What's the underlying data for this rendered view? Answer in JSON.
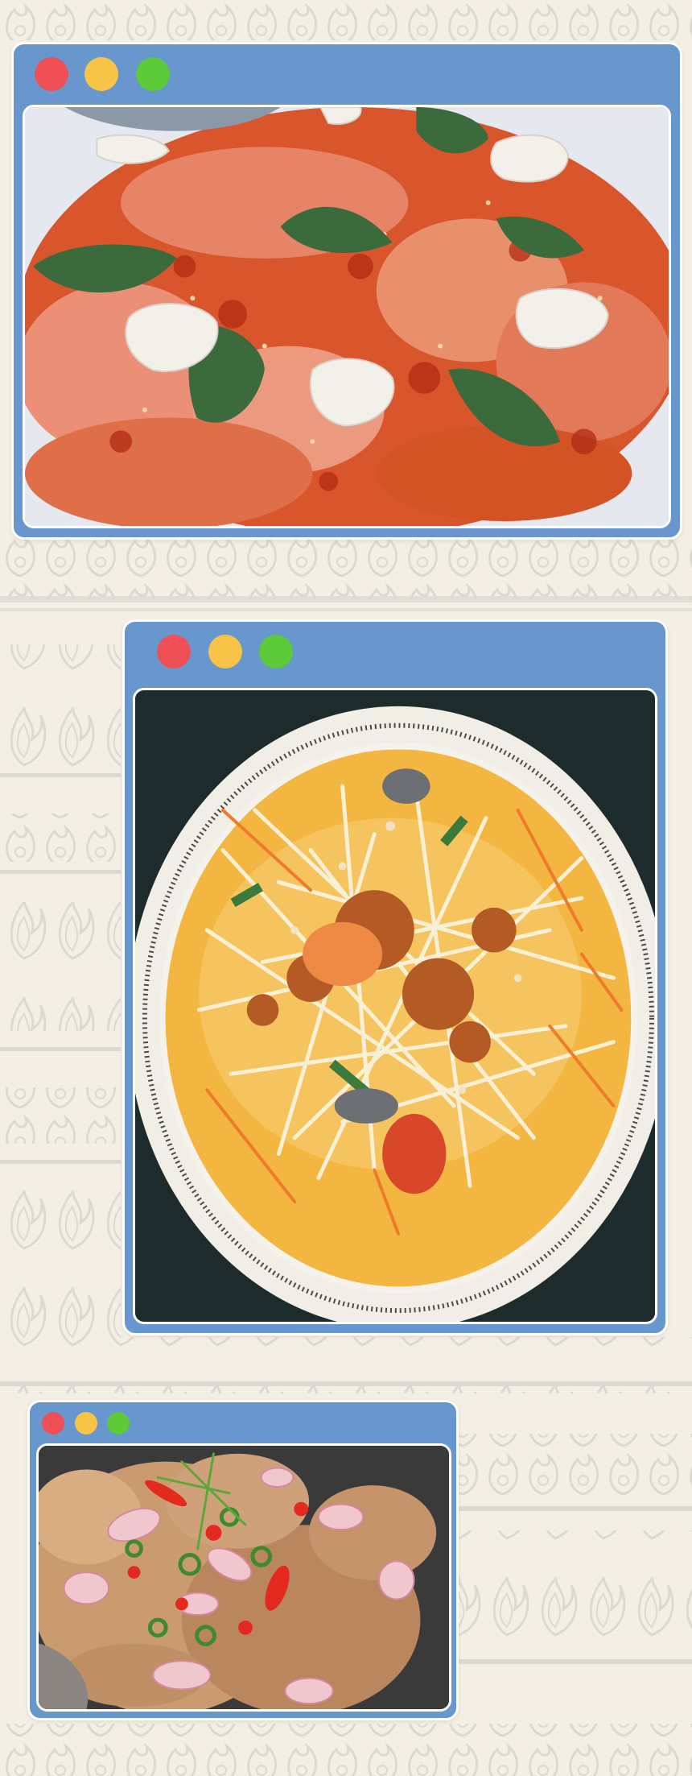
{
  "page": {
    "background_color": "#f3efe5",
    "pattern_color": "#d9d6d1",
    "window_color": "#6797cc",
    "frame_color": "#ffffff"
  },
  "windows": [
    {
      "controls": [
        {
          "icon": "close-dot-icon",
          "color": "#ef4f57"
        },
        {
          "icon": "minimize-dot-icon",
          "color": "#f8c447"
        },
        {
          "icon": "maximize-dot-icon",
          "color": "#5dcb39"
        }
      ],
      "photo": "salmon-spicy-salad-photo"
    },
    {
      "controls": [
        {
          "icon": "close-dot-icon",
          "color": "#ef4f57"
        },
        {
          "icon": "minimize-dot-icon",
          "color": "#f8c447"
        },
        {
          "icon": "maximize-dot-icon",
          "color": "#5dcb39"
        }
      ],
      "photo": "papaya-salad-photo"
    },
    {
      "controls": [
        {
          "icon": "close-dot-icon",
          "color": "#ef4f57"
        },
        {
          "icon": "minimize-dot-icon",
          "color": "#f8c447"
        },
        {
          "icon": "maximize-dot-icon",
          "color": "#5dcb39"
        }
      ],
      "photo": "chili-onion-stirfry-photo"
    }
  ]
}
